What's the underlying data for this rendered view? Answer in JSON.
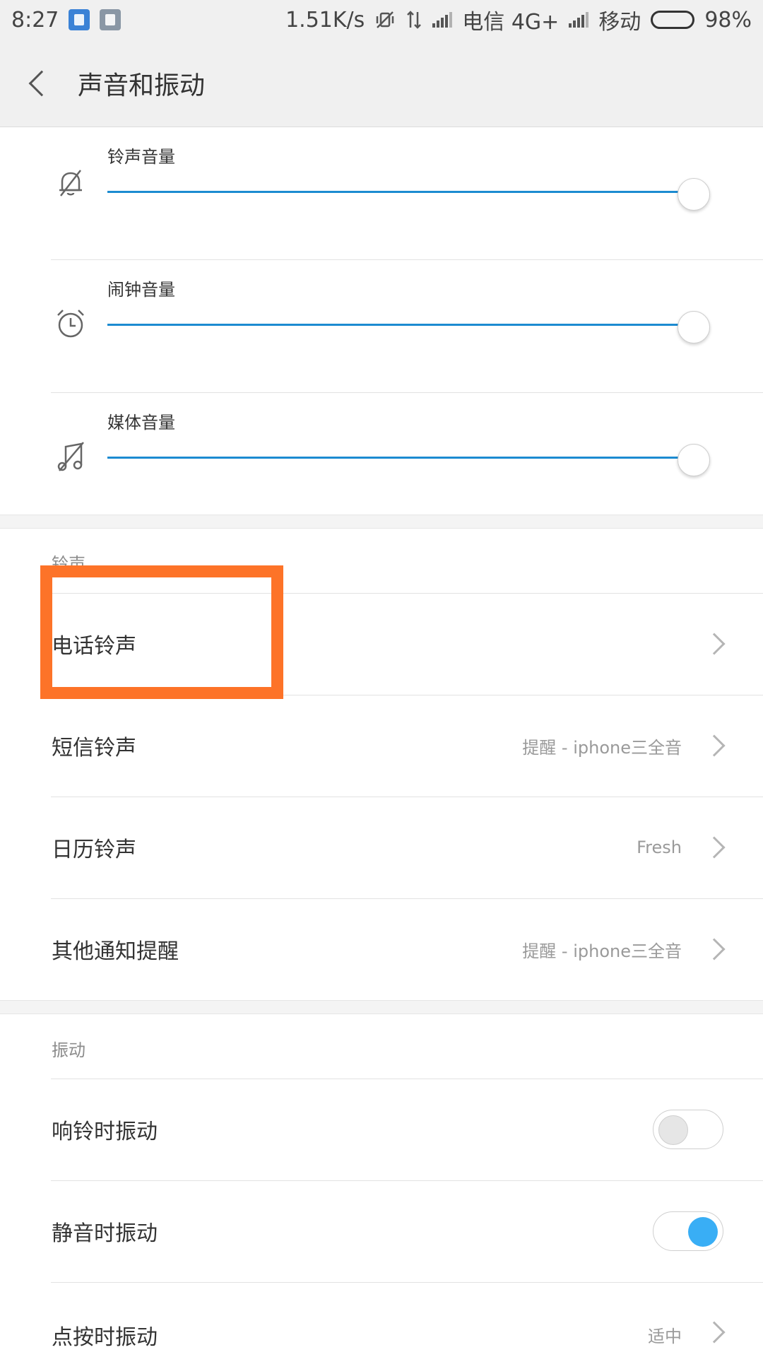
{
  "status_bar": {
    "time": "8:27",
    "net_speed": "1.51K/s",
    "carrier1": "电信 4G+",
    "carrier2": "移动",
    "battery_percent": "98%",
    "battery_level": 0.98
  },
  "header": {
    "title": "声音和振动",
    "back_icon": "chevron-left-icon"
  },
  "volume": [
    {
      "label": "铃声音量",
      "icon": "bell-muted-icon",
      "level": 1.0
    },
    {
      "label": "闹钟音量",
      "icon": "alarm-clock-icon",
      "level": 1.0
    },
    {
      "label": "媒体音量",
      "icon": "music-note-muted-icon",
      "level": 1.0
    }
  ],
  "ringtone_section": {
    "header": "铃声",
    "items": [
      {
        "label": "电话铃声",
        "value": ""
      },
      {
        "label": "短信铃声",
        "value": "提醒 - iphone三全音"
      },
      {
        "label": "日历铃声",
        "value": "Fresh"
      },
      {
        "label": "其他通知提醒",
        "value": "提醒 - iphone三全音"
      }
    ]
  },
  "vibration_section": {
    "header": "振动",
    "items": [
      {
        "label": "响铃时振动",
        "toggle": false
      },
      {
        "label": "静音时振动",
        "toggle": true
      },
      {
        "label": "点按时振动",
        "value": "适中"
      }
    ]
  },
  "colors": {
    "accent": "#1c8bd1",
    "toggle_on": "#39aef5",
    "highlight": "#fd7328"
  }
}
